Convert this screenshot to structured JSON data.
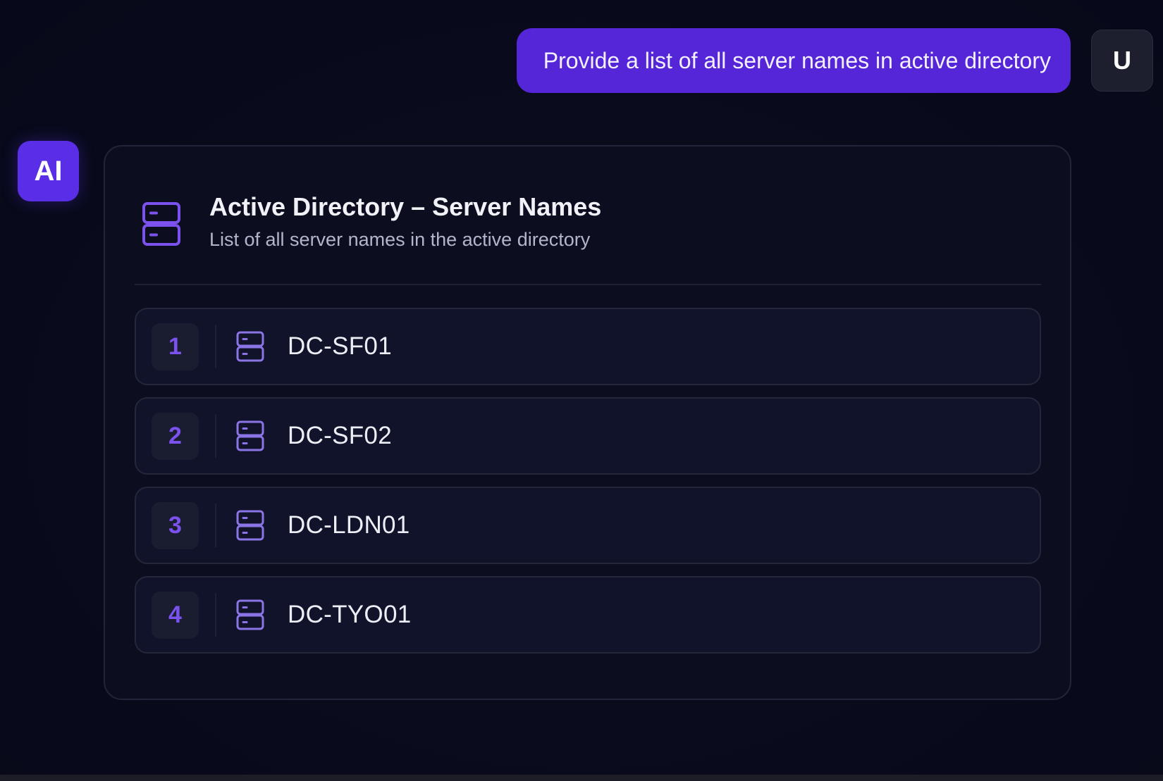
{
  "user_message": {
    "text": "Provide a list of all server names in active directory",
    "avatar_label": "U"
  },
  "assistant": {
    "avatar_label": "AI"
  },
  "card": {
    "title": "Active Directory – Server Names",
    "subtitle": "List of all server names in the active directory",
    "header_icon": "server-icon",
    "servers": [
      {
        "index": "1",
        "name": "DC-SF01",
        "icon": "server-icon"
      },
      {
        "index": "2",
        "name": "DC-SF02",
        "icon": "server-icon"
      },
      {
        "index": "3",
        "name": "DC-LDN01",
        "icon": "server-icon"
      },
      {
        "index": "4",
        "name": "DC-TYO01",
        "icon": "server-icon"
      }
    ]
  },
  "colors": {
    "accent": "#5526d8",
    "ai_avatar": "#5a2ee6",
    "index_text": "#7b52ee",
    "icon_stroke": "#8b74e6",
    "background": "#080a1b"
  }
}
